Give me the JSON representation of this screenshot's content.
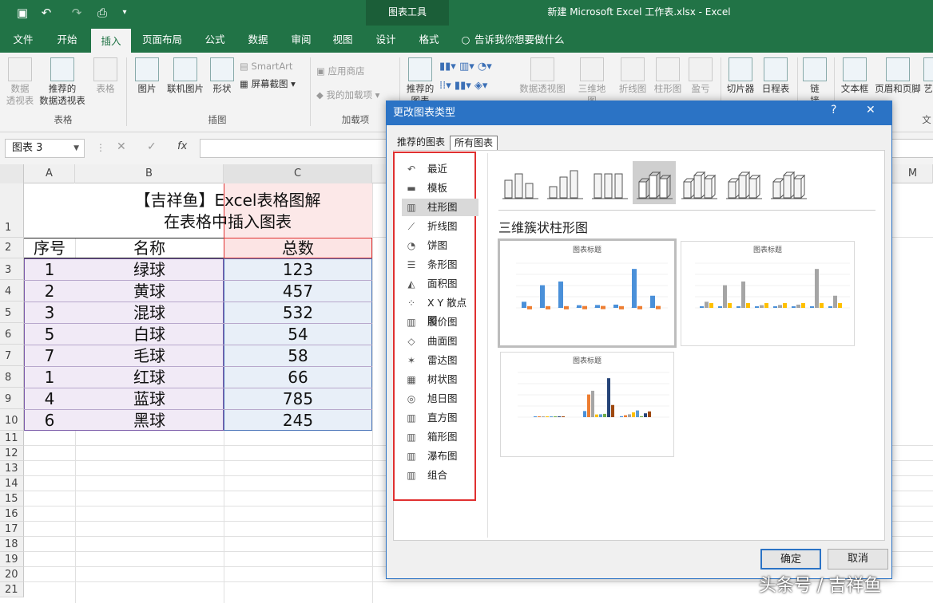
{
  "window": {
    "title": "新建 Microsoft Excel 工作表.xlsx  -  Excel",
    "context_group": "图表工具"
  },
  "tabs": [
    "文件",
    "开始",
    "插入",
    "页面布局",
    "公式",
    "数据",
    "审阅",
    "视图",
    "设计",
    "格式"
  ],
  "active_tab": "插入",
  "tell_me": "告诉我你想要做什么",
  "ribbon": {
    "pivot": "数据\n透视表",
    "recommended_pivot": "推荐的\n数据透视表",
    "table": "表格",
    "group_tables": "表格",
    "picture": "图片",
    "online_picture": "联机图片",
    "shapes": "形状",
    "smartart": "SmartArt",
    "screenshot": "屏幕截图",
    "group_illustrations": "插图",
    "store": "应用商店",
    "my_addins": "我的加载项",
    "group_addins": "加载项",
    "recommended_charts": "推荐的\n图表",
    "pivot_chart": "数据透视图",
    "map3d": "三维地\n图",
    "line": "折线图",
    "column": "柱形图",
    "winloss": "盈亏",
    "slicer": "切片器",
    "timeline": "日程表",
    "link": "链\n接",
    "textbox": "文本框",
    "header_footer": "页眉和页脚",
    "art": "艺",
    "text_group": "文"
  },
  "name_box": "图表 3",
  "formula_icons": {
    "cancel": "✕",
    "enter": "✓",
    "fx": "fx"
  },
  "columns": [
    "A",
    "B",
    "C",
    "M"
  ],
  "rows": [
    "1",
    "2",
    "3",
    "4",
    "5",
    "6",
    "7",
    "8",
    "9",
    "10",
    "11",
    "12",
    "13",
    "14",
    "15",
    "16",
    "17",
    "18",
    "19",
    "20",
    "21"
  ],
  "sheet": {
    "title_line1": "【吉祥鱼】Excel表格图解",
    "title_line2": "在表格中插入图表",
    "headers": [
      "序号",
      "名称",
      "总数"
    ],
    "data": [
      [
        "1",
        "绿球",
        "123"
      ],
      [
        "2",
        "黄球",
        "457"
      ],
      [
        "3",
        "混球",
        "532"
      ],
      [
        "5",
        "白球",
        "54"
      ],
      [
        "7",
        "毛球",
        "58"
      ],
      [
        "1",
        "红球",
        "66"
      ],
      [
        "4",
        "蓝球",
        "785"
      ],
      [
        "6",
        "黑球",
        "245"
      ]
    ]
  },
  "dialog": {
    "title": "更改图表类型",
    "help": "?",
    "close": "✕",
    "tab_recommended": "推荐的图表",
    "tab_all": "所有图表",
    "categories": [
      "最近",
      "模板",
      "柱形图",
      "折线图",
      "饼图",
      "条形图",
      "面积图",
      "X Y 散点图",
      "股价图",
      "曲面图",
      "雷达图",
      "树状图",
      "旭日图",
      "直方图",
      "箱形图",
      "瀑布图",
      "组合"
    ],
    "selected_category": "柱形图",
    "subtype_heading": "三维簇状柱形图",
    "preview_title": "图表标题",
    "ok": "确定",
    "cancel": "取消"
  },
  "watermark": "头条号 / 吉祥鱼",
  "colors": {
    "excel_green": "#217346",
    "dialog_blue": "#2b73c5",
    "highlight_red": "#e03030",
    "series_blue": "#4a90d9",
    "series_orange": "#ed7d31",
    "series_gray": "#a5a5a5",
    "series_yellow": "#ffc000"
  }
}
